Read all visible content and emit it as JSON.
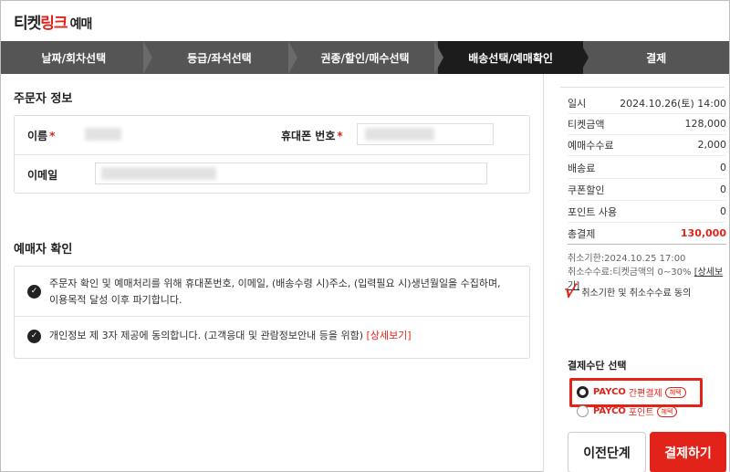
{
  "logo": {
    "part1": "티켓",
    "part2": "링크",
    "part3": "예매"
  },
  "steps": [
    {
      "label": "날짜/회차선택",
      "active": false
    },
    {
      "label": "등급/좌석선택",
      "active": false
    },
    {
      "label": "권종/할인/매수선택",
      "active": false
    },
    {
      "label": "배송선택/예매확인",
      "active": true
    },
    {
      "label": "결제",
      "active": false
    }
  ],
  "orderer": {
    "title": "주문자 정보",
    "name_label": "이름",
    "phone_label": "휴대폰 번호",
    "email_label": "이메일",
    "required_mark": "*"
  },
  "consent": {
    "title": "예매자 확인",
    "item1_line1": "주문자 확인 및 예매처리를 위해 휴대폰번호, 이메일, (배송수령 시)주소, (입력필요 시)생년월일을 수집하며,",
    "item1_line2": "이용목적 달성 이후 파기합니다.",
    "item2_text": "개인정보 제 3자 제공에 동의합니다. (고객응대 및 관람정보안내 등을 위함)",
    "item2_link": "[상세보기]"
  },
  "summary": {
    "rows": [
      {
        "label": "일시",
        "value": "2024.10.26(토) 14:00"
      },
      {
        "label": "티켓금액",
        "value": "128,000"
      },
      {
        "label": "예매수수료",
        "value": "2,000"
      },
      {
        "label": "배송료",
        "value": "0"
      },
      {
        "label": "쿠폰할인",
        "value": "0"
      },
      {
        "label": "포인트 사용",
        "value": "0"
      },
      {
        "label": "총결제",
        "value": "130,000"
      }
    ],
    "cancel_deadline": "취소기한:2024.10.25 17:00",
    "cancel_fee": "취소수수료:티켓금액의 0~30%",
    "cancel_fee_link": "[상세보기]",
    "agree_mark": "√",
    "agree_label": "취소기한 및 취소수수료 동의"
  },
  "payment": {
    "title": "결제수단 선택",
    "option1_brand": "PAYCO",
    "option1_type": "간편결제",
    "option1_badge": "혜택",
    "option2_brand": "PAYCO",
    "option2_type": "포인트",
    "option2_badge": "혜택"
  },
  "buttons": {
    "prev": "이전단계",
    "pay": "결제하기"
  },
  "colors": {
    "accent": "#e2231a",
    "step_bar": "#555555",
    "step_active": "#1c1c1c"
  }
}
